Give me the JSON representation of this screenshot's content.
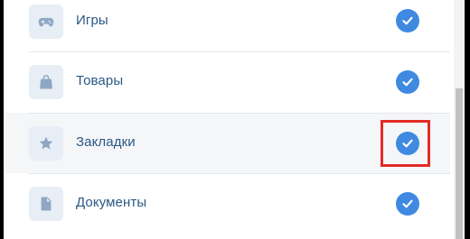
{
  "items": [
    {
      "label": "Игры",
      "icon": "gamepad-icon",
      "checked": true
    },
    {
      "label": "Товары",
      "icon": "shopping-bag-icon",
      "checked": true
    },
    {
      "label": "Закладки",
      "icon": "star-icon",
      "checked": true,
      "highlighted": true,
      "annotated": true
    },
    {
      "label": "Документы",
      "icon": "document-icon",
      "checked": true
    }
  ],
  "colors": {
    "label": "#2a5885",
    "checkbox": "#3f8ae0",
    "icon": "#8fa7c5",
    "icon_bg": "#e8eef5",
    "highlight_bg": "#f5f6f8",
    "annotation": "#e32b26"
  }
}
